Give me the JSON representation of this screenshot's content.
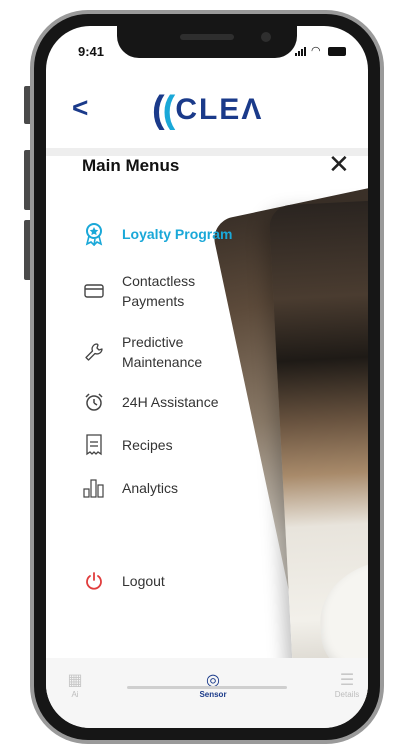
{
  "status_bar": {
    "time": "9:41"
  },
  "header": {
    "back_label": "<",
    "logo_text": "CLEΛ"
  },
  "menu": {
    "title": "Main Menus",
    "close_label": "✕",
    "items": [
      {
        "label": "Loyalty Program",
        "icon": "loyalty-badge-icon",
        "active": true
      },
      {
        "label": "Contactless\nPayments",
        "icon": "card-icon",
        "active": false
      },
      {
        "label": "Predictive\nMaintenance",
        "icon": "wrench-icon",
        "active": false
      },
      {
        "label": "24H Assistance",
        "icon": "clock-icon",
        "active": false
      },
      {
        "label": "Recipes",
        "icon": "receipt-icon",
        "active": false
      },
      {
        "label": "Analytics",
        "icon": "bar-chart-icon",
        "active": false
      }
    ],
    "logout_label": "Logout"
  },
  "tabbar": {
    "tabs": [
      {
        "label": "Ai",
        "icon": "ai-icon",
        "active": false
      },
      {
        "label": "Sensor",
        "icon": "sensor-icon",
        "active": true
      },
      {
        "label": "Details",
        "icon": "details-icon",
        "active": false
      }
    ]
  },
  "colors": {
    "brand": "#1a3a8a",
    "accent": "#1aa8d8",
    "logout": "#e03c3c"
  }
}
